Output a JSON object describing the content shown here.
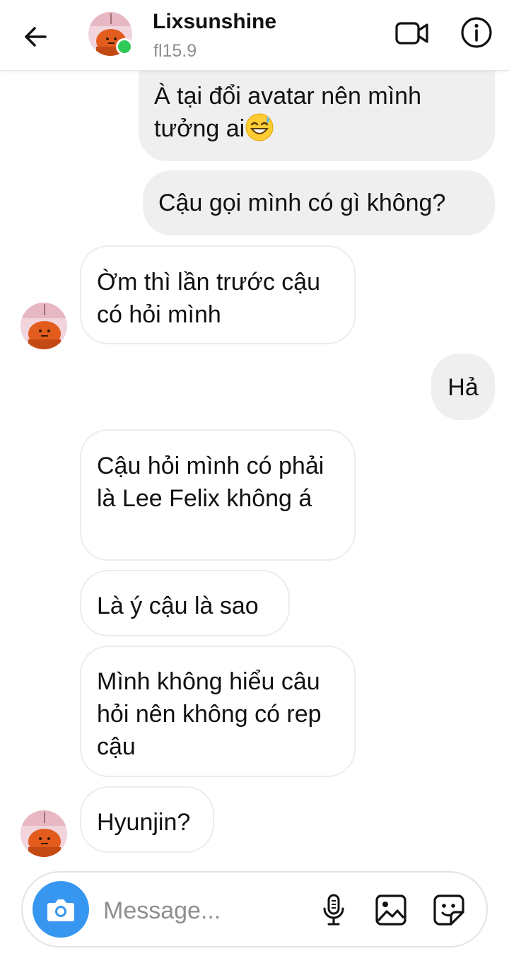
{
  "header": {
    "name": "Lixsunshine",
    "subtitle": "fl15.9",
    "online": true,
    "back_icon": "arrow-left-icon",
    "video_icon": "video-camera-icon",
    "info_icon": "info-icon"
  },
  "messages": [
    {
      "direction": "out",
      "text": "À tại đổi avatar nên mình tưởng ai",
      "emoji": "grinning-sweat-emoji"
    },
    {
      "direction": "out",
      "text": "Cậu gọi mình có gì không?"
    },
    {
      "direction": "in",
      "text": "Ờm thì lần trước cậu có hỏi mình"
    },
    {
      "direction": "out",
      "text": "Hả"
    },
    {
      "direction": "in",
      "text": "Cậu hỏi mình có phải là Lee Felix không á"
    },
    {
      "direction": "in",
      "text": "Là ý cậu là sao"
    },
    {
      "direction": "in",
      "text": "Mình không hiểu câu hỏi nên không có rep cậu"
    },
    {
      "direction": "in",
      "text": "Hyunjin?"
    }
  ],
  "composer": {
    "placeholder": "Message...",
    "value": "",
    "camera_icon": "camera-icon",
    "mic_icon": "microphone-icon",
    "gallery_icon": "gallery-icon",
    "sticker_icon": "sticker-icon"
  },
  "colors": {
    "accent": "#3797f0",
    "online": "#2ec957",
    "outgoing_bubble": "#efefef",
    "incoming_border": "#ececec",
    "secondary_text": "#8e8e8e"
  }
}
